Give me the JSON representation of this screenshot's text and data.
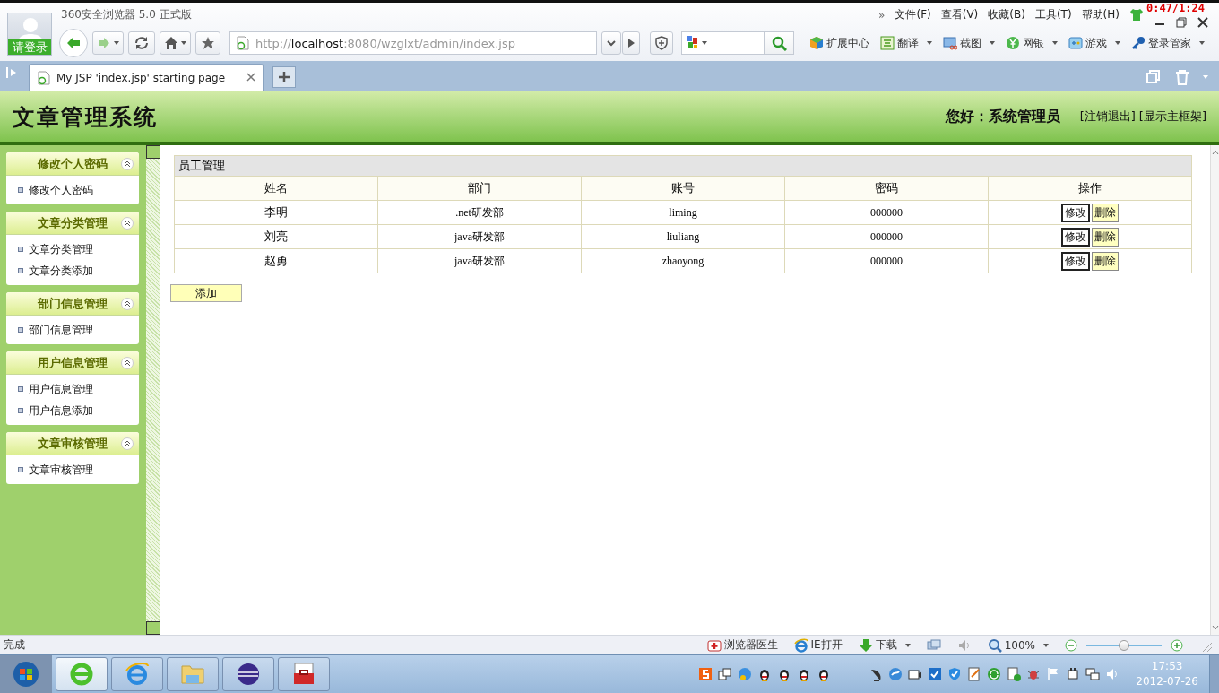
{
  "browser": {
    "title": "360安全浏览器 5.0 正式版",
    "login_label": "请登录",
    "menu_overflow": "»",
    "menu": [
      "文件(F)",
      "查看(V)",
      "收藏(B)",
      "工具(T)",
      "帮助(H)"
    ],
    "recording_timer": "0:47/1:24",
    "url": {
      "scheme": "http://",
      "host": "localhost",
      "path": ":8080/wzglxt/admin/index.jsp"
    },
    "tools": [
      {
        "label": "扩展中心",
        "kind": "extensions",
        "dropdown": false
      },
      {
        "label": "翻译",
        "kind": "translate",
        "dropdown": true
      },
      {
        "label": "截图",
        "kind": "screenshot",
        "dropdown": true
      },
      {
        "label": "网银",
        "kind": "bank",
        "dropdown": true
      },
      {
        "label": "游戏",
        "kind": "games",
        "dropdown": true
      },
      {
        "label": "登录管家",
        "kind": "key",
        "dropdown": true
      }
    ]
  },
  "tabs": [
    {
      "label": "My JSP 'index.jsp' starting page",
      "selected": true
    }
  ],
  "page": {
    "title": "文章管理系统",
    "greeting": "您好：系统管理员",
    "links": [
      "[注销退出]",
      "[显示主框架]"
    ]
  },
  "sidebar": [
    {
      "title": "修改个人密码",
      "expanded": true,
      "items": [
        "修改个人密码"
      ]
    },
    {
      "title": "文章分类管理",
      "expanded": true,
      "items": [
        "文章分类管理",
        "文章分类添加"
      ]
    },
    {
      "title": "部门信息管理",
      "expanded": true,
      "items": [
        "部门信息管理"
      ]
    },
    {
      "title": "用户信息管理",
      "expanded": true,
      "items": [
        "用户信息管理",
        "用户信息添加"
      ]
    },
    {
      "title": "文章审核管理",
      "expanded": true,
      "items": [
        "文章审核管理"
      ]
    }
  ],
  "panel": {
    "caption": "员工管理",
    "columns": [
      "姓名",
      "部门",
      "账号",
      "密码",
      "操作"
    ],
    "rows": [
      {
        "cells": [
          "李明",
          ".net研发部",
          "liming",
          "000000"
        ],
        "actions": [
          "修改",
          "删除"
        ]
      },
      {
        "cells": [
          "刘亮",
          "java研发部",
          "liuliang",
          "000000"
        ],
        "actions": [
          "修改",
          "删除"
        ]
      },
      {
        "cells": [
          "赵勇",
          "java研发部",
          "zhaoyong",
          "000000"
        ],
        "actions": [
          "修改",
          "删除"
        ]
      }
    ],
    "add_button": "添加"
  },
  "status_bar": {
    "text": "完成",
    "items": [
      {
        "label": "浏览器医生",
        "kind": "doctor"
      },
      {
        "label": "IE打开",
        "kind": "ie"
      },
      {
        "label": "下载",
        "kind": "download"
      }
    ],
    "zoom": "100%",
    "zoom_slider": {
      "level": 0.5
    }
  },
  "taskbar": {
    "time": "17:53",
    "date": "2012-07-26"
  }
}
